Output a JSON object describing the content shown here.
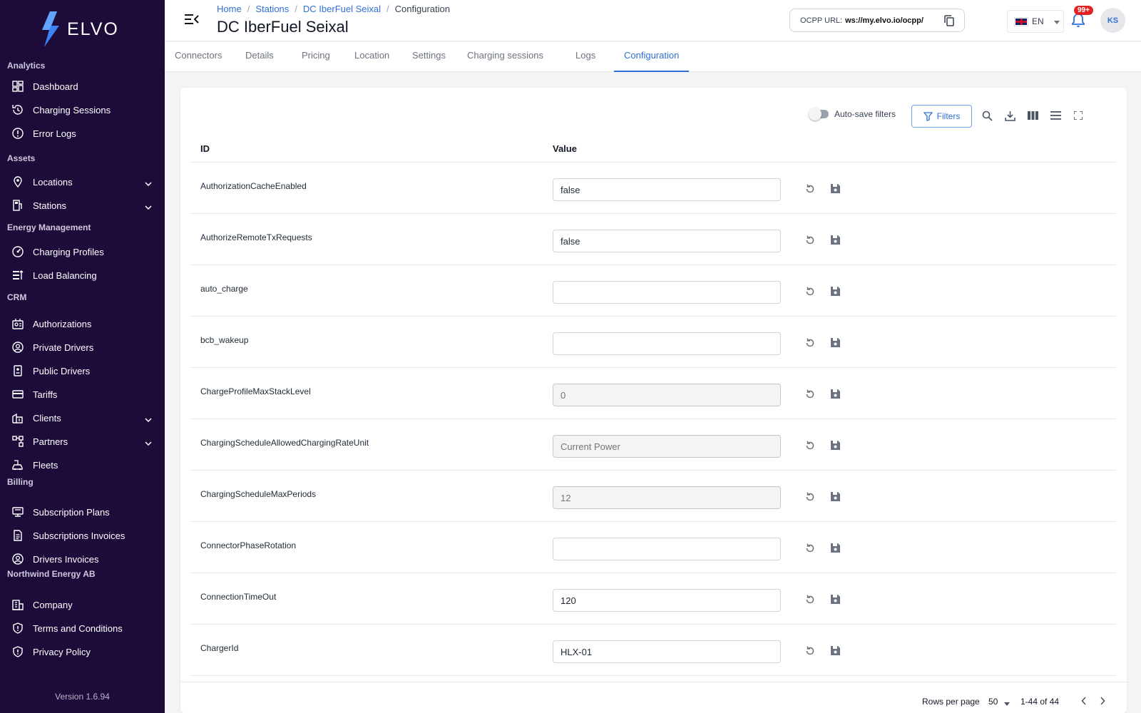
{
  "app": {
    "brand": "ELVO",
    "version": "Version 1.6.94",
    "accent": "#2f6fd6",
    "sidebar_bg": "#1d0b3a"
  },
  "sidebar": {
    "sections": [
      {
        "title": "Analytics",
        "items": [
          {
            "label": "Dashboard",
            "icon": "dashboard-icon"
          },
          {
            "label": "Charging Sessions",
            "icon": "history-icon"
          },
          {
            "label": "Error Logs",
            "icon": "error-icon"
          }
        ]
      },
      {
        "title": "Assets",
        "items": [
          {
            "label": "Locations",
            "icon": "location-pin-icon",
            "expandable": true
          },
          {
            "label": "Stations",
            "icon": "station-icon",
            "expandable": true
          }
        ]
      },
      {
        "title": "Energy Management",
        "items": [
          {
            "label": "Charging Profiles",
            "icon": "speedometer-icon"
          },
          {
            "label": "Load Balancing",
            "icon": "balance-icon"
          }
        ]
      },
      {
        "title": "CRM",
        "items": [
          {
            "label": "Authorizations",
            "icon": "authorization-icon"
          },
          {
            "label": "Private Drivers",
            "icon": "user-circle-icon"
          },
          {
            "label": "Public Drivers",
            "icon": "badge-icon"
          },
          {
            "label": "Tariffs",
            "icon": "card-icon"
          },
          {
            "label": "Clients",
            "icon": "clients-icon",
            "expandable": true
          },
          {
            "label": "Partners",
            "icon": "partners-icon",
            "expandable": true
          },
          {
            "label": "Fleets",
            "icon": "fleet-icon"
          }
        ]
      },
      {
        "title": "Billing",
        "items": [
          {
            "label": "Subscription Plans",
            "icon": "plans-icon"
          },
          {
            "label": "Subscriptions Invoices",
            "icon": "invoice-icon"
          },
          {
            "label": "Drivers Invoices",
            "icon": "user-circle-icon"
          }
        ]
      },
      {
        "title": "Northwind Energy AB",
        "items": [
          {
            "label": "Company",
            "icon": "company-icon"
          },
          {
            "label": "Terms and Conditions",
            "icon": "shield-icon"
          },
          {
            "label": "Privacy Policy",
            "icon": "shield-icon"
          }
        ]
      }
    ]
  },
  "header": {
    "breadcrumb": [
      "Home",
      "Stations",
      "DC IberFuel Seixal",
      "Configuration"
    ],
    "title": "DC IberFuel Seixal",
    "ocpp_label": "OCPP URL:",
    "ocpp_url": "ws://my.elvo.io/ocpp/",
    "language": "EN",
    "notifications": "99+",
    "user_initials": "KS"
  },
  "tabs": [
    "Connectors",
    "Details",
    "Pricing",
    "Location",
    "Settings",
    "Charging sessions",
    "Logs",
    "Configuration"
  ],
  "active_tab": "Configuration",
  "toolbar": {
    "autosave_label": "Auto-save filters",
    "autosave_on": false,
    "filters_label": "Filters"
  },
  "table": {
    "columns": [
      "ID",
      "Value"
    ],
    "rows": [
      {
        "id": "AuthorizationCacheEnabled",
        "value": "false",
        "placeholder": "",
        "readonly": false
      },
      {
        "id": "AuthorizeRemoteTxRequests",
        "value": "false",
        "placeholder": "",
        "readonly": false
      },
      {
        "id": "auto_charge",
        "value": "",
        "placeholder": "",
        "readonly": false
      },
      {
        "id": "bcb_wakeup",
        "value": "",
        "placeholder": "",
        "readonly": false
      },
      {
        "id": "ChargeProfileMaxStackLevel",
        "value": "",
        "placeholder": "0",
        "readonly": true
      },
      {
        "id": "ChargingScheduleAllowedChargingRateUnit",
        "value": "",
        "placeholder": "Current Power",
        "readonly": true
      },
      {
        "id": "ChargingScheduleMaxPeriods",
        "value": "",
        "placeholder": "12",
        "readonly": true
      },
      {
        "id": "ConnectorPhaseRotation",
        "value": "",
        "placeholder": "",
        "readonly": false
      },
      {
        "id": "ConnectionTimeOut",
        "value": "120",
        "placeholder": "",
        "readonly": false
      },
      {
        "id": "ChargerId",
        "value": "HLX-01",
        "placeholder": "",
        "readonly": false
      }
    ]
  },
  "pagination": {
    "rows_label": "Rows per page",
    "rows_value": "50",
    "range": "1-44 of 44"
  }
}
